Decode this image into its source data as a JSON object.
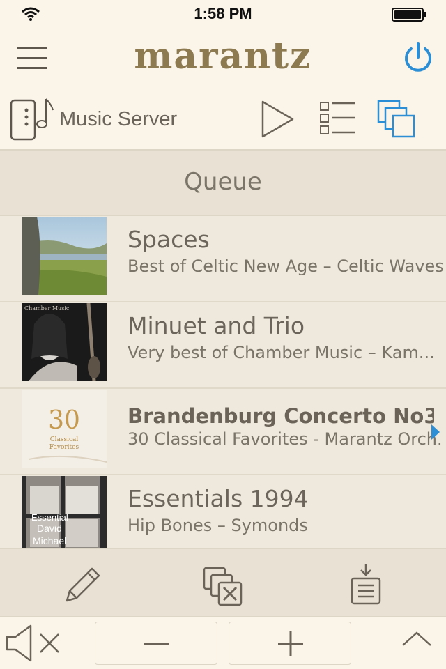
{
  "status_bar": {
    "time": "1:58 PM"
  },
  "header": {
    "brand": "marantz"
  },
  "source": {
    "label": "Music Server"
  },
  "queue": {
    "title": "Queue",
    "items": [
      {
        "title": "Spaces",
        "subtitle": "Best of Celtic New Age – Celtic Waves",
        "now_playing": false
      },
      {
        "title": "Minuet and Trio",
        "subtitle": "Very best of Chamber  Music – Kam...",
        "now_playing": false,
        "art_text": "Chamber Music"
      },
      {
        "title": "Brandenburg Concerto No3.",
        "subtitle": "30 Classical Favorites - Marantz Orch...",
        "now_playing": true,
        "art_text": [
          "30",
          "Classical",
          "Favorites"
        ]
      },
      {
        "title": "Essentials 1994",
        "subtitle": "Hip Bones – Symonds",
        "now_playing": false,
        "art_text": [
          "Essential",
          "David",
          "Michael"
        ]
      }
    ]
  },
  "colors": {
    "accent": "#2c8fd6",
    "brand": "#8e7a51",
    "background": "#f7f1e6",
    "icon": "#6b6358"
  },
  "icons": {
    "wifi": "wifi-icon",
    "battery": "battery-icon",
    "menu": "hamburger-menu-icon",
    "power": "power-icon",
    "device": "music-server-device-icon",
    "play": "play-icon",
    "list": "list-icon",
    "windows": "zone-windows-icon",
    "edit": "pencil-icon",
    "clear": "clear-queue-icon",
    "save": "save-queue-icon",
    "mute": "speaker-mute-icon",
    "minus": "minus-icon",
    "plus": "plus-icon",
    "expand": "chevron-up-icon",
    "now_playing": "now-playing-arrow-icon"
  }
}
